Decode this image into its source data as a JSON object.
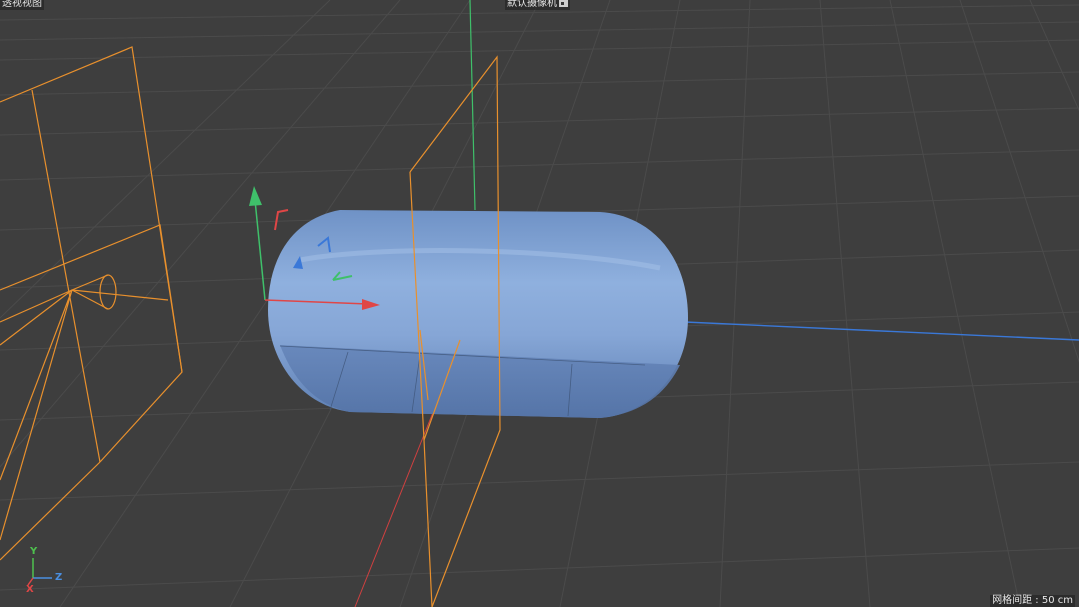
{
  "viewport": {
    "view_name": "透视视图",
    "camera_label": "默认摄像机",
    "camera_icon": "camera-icon",
    "grid_spacing": "网格间距 : 50 cm"
  },
  "axis_gizmo": {
    "y": "Y",
    "z": "Z",
    "x": "X"
  },
  "colors": {
    "background": "#3e3e3e",
    "grid": "#4c4c4c",
    "object": "#7f9fce",
    "bounds": "#e8902d",
    "axis_x": "#e04646",
    "axis_y": "#3fc06a",
    "axis_z": "#3a78d8"
  }
}
